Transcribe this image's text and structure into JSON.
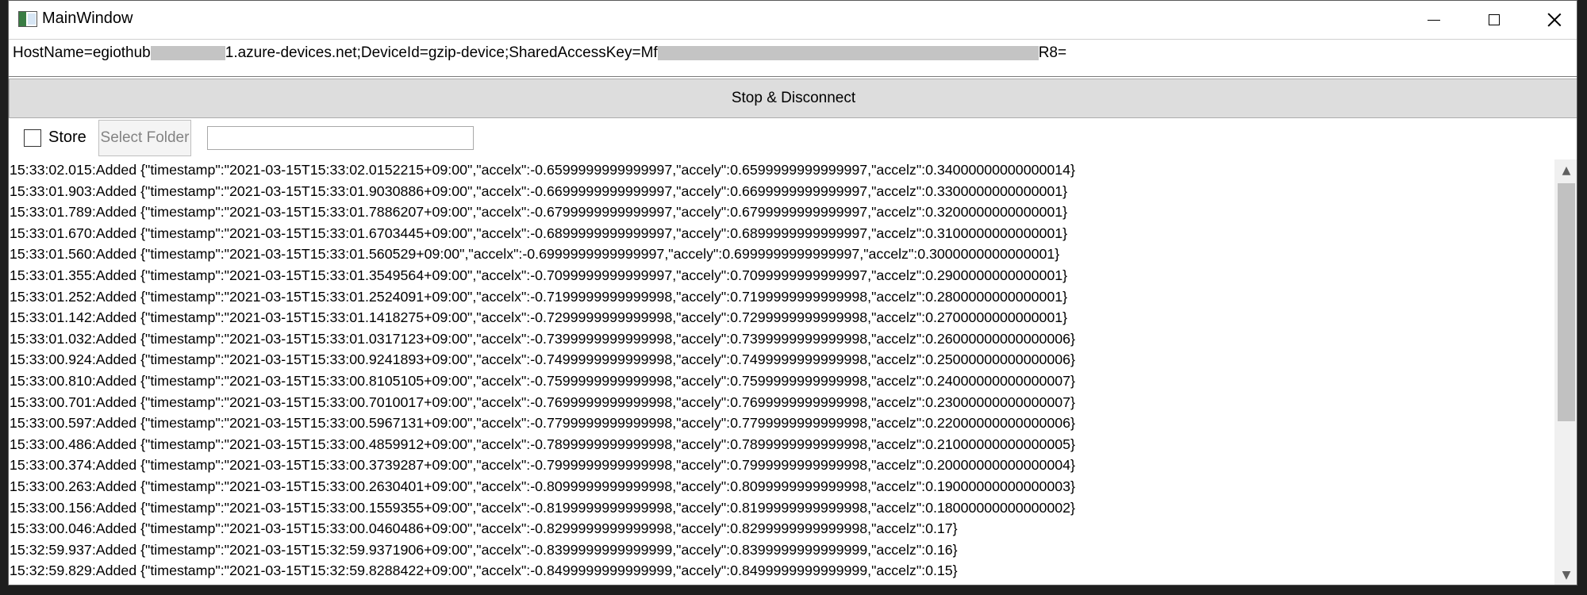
{
  "window": {
    "title": "MainWindow"
  },
  "connection": {
    "prefix": "HostName=egiothub",
    "mid1": "1.azure-devices.net;DeviceId=gzip-device;SharedAccessKey=Mf",
    "suffix": "R8="
  },
  "controls": {
    "stop_label": "Stop & Disconnect",
    "store_label": "Store",
    "select_folder_label": "Select Folder",
    "folder_path": ""
  },
  "log": [
    "15:33:02.015:Added {\"timestamp\":\"2021-03-15T15:33:02.0152215+09:00\",\"accelx\":-0.6599999999999997,\"accely\":0.6599999999999997,\"accelz\":0.34000000000000014}",
    "15:33:01.903:Added {\"timestamp\":\"2021-03-15T15:33:01.9030886+09:00\",\"accelx\":-0.6699999999999997,\"accely\":0.6699999999999997,\"accelz\":0.3300000000000001}",
    "15:33:01.789:Added {\"timestamp\":\"2021-03-15T15:33:01.7886207+09:00\",\"accelx\":-0.6799999999999997,\"accely\":0.6799999999999997,\"accelz\":0.3200000000000001}",
    "15:33:01.670:Added {\"timestamp\":\"2021-03-15T15:33:01.6703445+09:00\",\"accelx\":-0.6899999999999997,\"accely\":0.6899999999999997,\"accelz\":0.3100000000000001}",
    "15:33:01.560:Added {\"timestamp\":\"2021-03-15T15:33:01.560529+09:00\",\"accelx\":-0.6999999999999997,\"accely\":0.6999999999999997,\"accelz\":0.3000000000000001}",
    "15:33:01.355:Added {\"timestamp\":\"2021-03-15T15:33:01.3549564+09:00\",\"accelx\":-0.7099999999999997,\"accely\":0.7099999999999997,\"accelz\":0.2900000000000001}",
    "15:33:01.252:Added {\"timestamp\":\"2021-03-15T15:33:01.2524091+09:00\",\"accelx\":-0.7199999999999998,\"accely\":0.7199999999999998,\"accelz\":0.2800000000000001}",
    "15:33:01.142:Added {\"timestamp\":\"2021-03-15T15:33:01.1418275+09:00\",\"accelx\":-0.7299999999999998,\"accely\":0.7299999999999998,\"accelz\":0.2700000000000001}",
    "15:33:01.032:Added {\"timestamp\":\"2021-03-15T15:33:01.0317123+09:00\",\"accelx\":-0.7399999999999998,\"accely\":0.7399999999999998,\"accelz\":0.26000000000000006}",
    "15:33:00.924:Added {\"timestamp\":\"2021-03-15T15:33:00.9241893+09:00\",\"accelx\":-0.7499999999999998,\"accely\":0.7499999999999998,\"accelz\":0.25000000000000006}",
    "15:33:00.810:Added {\"timestamp\":\"2021-03-15T15:33:00.8105105+09:00\",\"accelx\":-0.7599999999999998,\"accely\":0.7599999999999998,\"accelz\":0.24000000000000007}",
    "15:33:00.701:Added {\"timestamp\":\"2021-03-15T15:33:00.7010017+09:00\",\"accelx\":-0.7699999999999998,\"accely\":0.7699999999999998,\"accelz\":0.23000000000000007}",
    "15:33:00.597:Added {\"timestamp\":\"2021-03-15T15:33:00.5967131+09:00\",\"accelx\":-0.7799999999999998,\"accely\":0.7799999999999998,\"accelz\":0.22000000000000006}",
    "15:33:00.486:Added {\"timestamp\":\"2021-03-15T15:33:00.4859912+09:00\",\"accelx\":-0.7899999999999998,\"accely\":0.7899999999999998,\"accelz\":0.21000000000000005}",
    "15:33:00.374:Added {\"timestamp\":\"2021-03-15T15:33:00.3739287+09:00\",\"accelx\":-0.7999999999999998,\"accely\":0.7999999999999998,\"accelz\":0.20000000000000004}",
    "15:33:00.263:Added {\"timestamp\":\"2021-03-15T15:33:00.2630401+09:00\",\"accelx\":-0.8099999999999998,\"accely\":0.8099999999999998,\"accelz\":0.19000000000000003}",
    "15:33:00.156:Added {\"timestamp\":\"2021-03-15T15:33:00.1559355+09:00\",\"accelx\":-0.8199999999999998,\"accely\":0.8199999999999998,\"accelz\":0.18000000000000002}",
    "15:33:00.046:Added {\"timestamp\":\"2021-03-15T15:33:00.0460486+09:00\",\"accelx\":-0.8299999999999998,\"accely\":0.8299999999999998,\"accelz\":0.17}",
    "15:32:59.937:Added {\"timestamp\":\"2021-03-15T15:32:59.9371906+09:00\",\"accelx\":-0.8399999999999999,\"accely\":0.8399999999999999,\"accelz\":0.16}",
    "15:32:59.829:Added {\"timestamp\":\"2021-03-15T15:32:59.8288422+09:00\",\"accelx\":-0.8499999999999999,\"accely\":0.8499999999999999,\"accelz\":0.15}"
  ]
}
